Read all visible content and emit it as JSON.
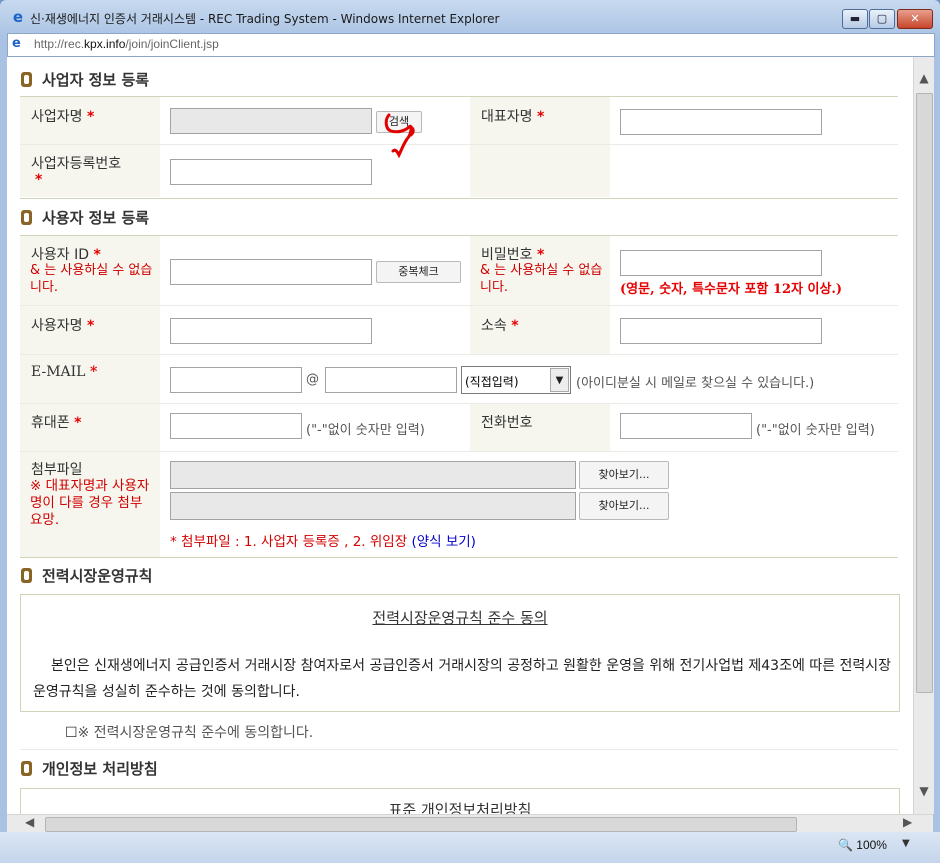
{
  "window": {
    "title": "신·재생에너지 인증서 거래시스템 - REC Trading System - Windows Internet Explorer",
    "url_prefix": "http://rec.",
    "url_domain": "kpx.info",
    "url_path": "/join/joinClient.jsp",
    "min_glyph": "▬",
    "max_glyph": "▢",
    "close_glyph": "✕"
  },
  "business": {
    "section_title": "사업자 정보 등록",
    "business_name_label": "사업자명",
    "search_button": "검색",
    "ceo_label": "대표자명",
    "reg_no_label_line1": "사업자등록번호",
    "required_mark": "*"
  },
  "user": {
    "section_title": "사용자 정보 등록",
    "user_id_label": "사용자 ID",
    "id_warning": "& 는 사용하실 수 없습니다.",
    "dup_check_button": "중복체크",
    "password_label": "비밀번호",
    "pw_warning": "& 는 사용하실 수 없습니다.",
    "pw_rule": "(영문, 숫자, 특수문자 포함 12자 이상.)",
    "user_name_label": "사용자명",
    "dept_label": "소속",
    "email_label": "E-MAIL",
    "at_sign": "@",
    "email_domain_selected": "(직접입력)",
    "email_hint": "(아이디분실 시 메일로 찾으실 수 있습니다.)",
    "mobile_label": "휴대폰",
    "mobile_hint": "(\"-\"없이 숫자만 입력)",
    "phone_label": "전화번호",
    "phone_hint": "(\"-\"없이 숫자만 입력)",
    "attach_label": "첨부파일",
    "attach_warning": "※ 대표자명과 사용자명이 다를 경우 첨부 요망.",
    "browse_button_1": "찾아보기...",
    "browse_button_2": "찾아보기...",
    "attach_note": "* 첨부파일 : 1. 사업자 등록증 , 2. 위임장",
    "attach_note_link": "(양식 보기)"
  },
  "rules": {
    "section_title": "전력시장운영규칙",
    "box_title": "전력시장운영규칙 준수 동의",
    "box_body": "본인은 신재생에너지 공급인증서 거래시장 참여자로서 공급인증서 거래시장의 공정하고 원활한 운영을 위해 전기사업법 제43조에 따른 전력시장운영규칙을 성실히 준수하는 것에 동의합니다.",
    "agree_checkbox_label": "※ 전력시장운영규칙 준수에 동의합니다.",
    "agree_checked": false
  },
  "privacy": {
    "section_title": "개인정보 처리방침",
    "box_title": "표준 개인정보처리방침"
  },
  "status": {
    "zoom": "100%"
  },
  "colors": {
    "label_bg": "#f6f6ef",
    "required_red": "#e60000",
    "link_blue": "#0000cc",
    "section_bullet": "#8a6426"
  }
}
